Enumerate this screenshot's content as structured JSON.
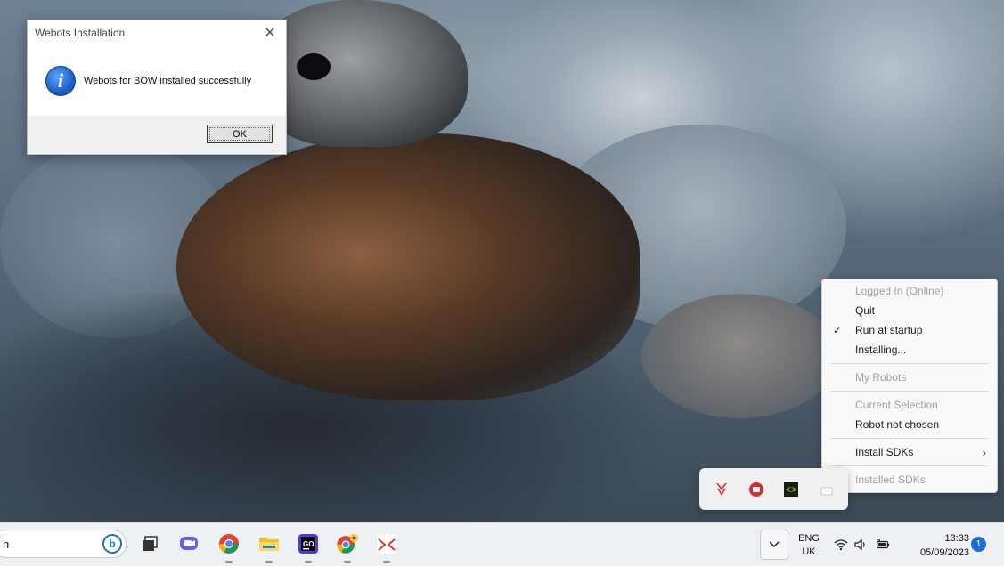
{
  "dialog": {
    "title": "Webots Installation",
    "message": "Webots for BOW installed successfully",
    "ok_label": "OK"
  },
  "context_menu": {
    "items": [
      {
        "label": "Logged In (Online)",
        "enabled": false
      },
      {
        "label": "Quit",
        "enabled": true
      },
      {
        "label": "Run at startup",
        "enabled": true,
        "checked": true
      },
      {
        "label": "Installing...",
        "enabled": true
      },
      {
        "label": "My Robots",
        "enabled": false
      },
      {
        "label": "Current Selection",
        "enabled": false
      },
      {
        "label": "Robot not chosen",
        "enabled": true
      },
      {
        "label": "Install SDKs",
        "enabled": true,
        "submenu": true
      },
      {
        "label": "Installed SDKs",
        "enabled": false
      }
    ]
  },
  "tray_overflow": {
    "icons": [
      "bow-icon",
      "record-icon",
      "nvidia-icon",
      "app-icon"
    ]
  },
  "taskbar": {
    "search_text": "h",
    "apps": [
      "task-view-icon",
      "chat-icon",
      "chrome-icon",
      "file-explorer-icon",
      "goland-icon",
      "chrome-profile-icon",
      "bow-app-icon"
    ],
    "language_line1": "ENG",
    "language_line2": "UK",
    "time": "13:33",
    "date": "05/09/2023",
    "notification_count": "1"
  },
  "colors": {
    "accent": "#1a6fd1",
    "disabled_text": "#a0a0a0"
  }
}
